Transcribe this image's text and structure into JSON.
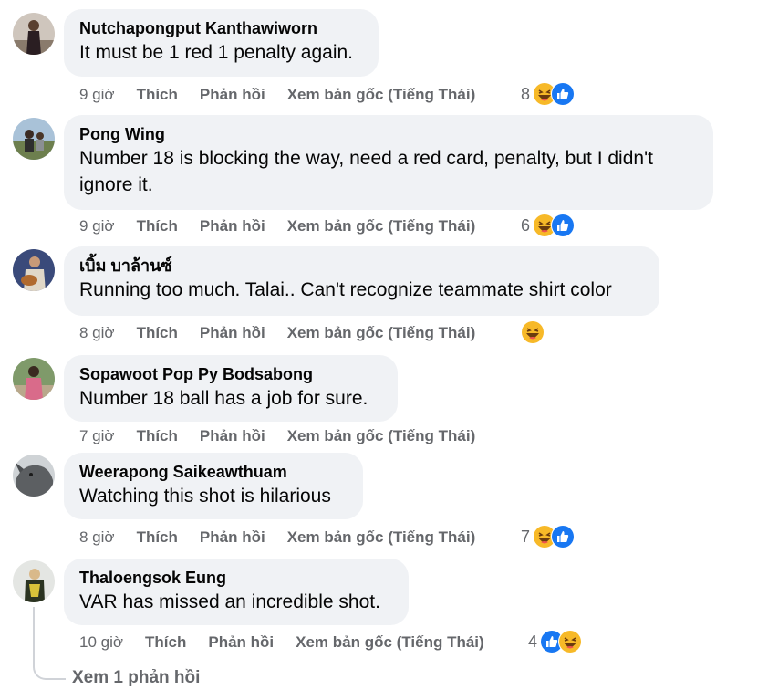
{
  "comments": [
    {
      "author": "Nutchapongput Kanthawiworn",
      "text": "It must be 1 red 1 penalty again.",
      "time": "9 giờ",
      "like": "Thích",
      "reply": "Phản hồi",
      "translate": "Xem bản gốc (Tiếng Thái)",
      "reaction_count": "8",
      "reactions": [
        "haha-icon",
        "like-icon"
      ]
    },
    {
      "author": "Pong Wing",
      "text": "Number 18 is blocking the way, need a red card, penalty, but I didn't ignore it.",
      "time": "9 giờ",
      "like": "Thích",
      "reply": "Phản hồi",
      "translate": "Xem bản gốc (Tiếng Thái)",
      "reaction_count": "6",
      "reactions": [
        "haha-icon",
        "like-icon"
      ]
    },
    {
      "author": "เบิ้ม บาล้านซ์",
      "text": "Running too much. Talai.. Can't recognize teammate shirt color",
      "time": "8 giờ",
      "like": "Thích",
      "reply": "Phản hồi",
      "translate": "Xem bản gốc (Tiếng Thái)",
      "reaction_count": "",
      "reactions": [
        "haha-icon"
      ]
    },
    {
      "author": "Sopawoot Pop Py Bodsabong",
      "text": "Number 18 ball has a job for sure.",
      "time": "7 giờ",
      "like": "Thích",
      "reply": "Phản hồi",
      "translate": "Xem bản gốc (Tiếng Thái)",
      "reaction_count": "",
      "reactions": []
    },
    {
      "author": "Weerapong Saikeawthuam",
      "text": "Watching this shot is hilarious",
      "time": "8 giờ",
      "like": "Thích",
      "reply": "Phản hồi",
      "translate": "Xem bản gốc (Tiếng Thái)",
      "reaction_count": "7",
      "reactions": [
        "haha-icon",
        "like-icon"
      ]
    },
    {
      "author": "Thaloengsok Eung",
      "text": "VAR has missed an incredible shot.",
      "time": "10 giờ",
      "like": "Thích",
      "reply": "Phản hồi",
      "translate": "Xem bản gốc (Tiếng Thái)",
      "reaction_count": "4",
      "reactions": [
        "like-icon",
        "haha-icon"
      ]
    }
  ],
  "view_replies": "Xem 1 phản hồi",
  "colors": {
    "bubble": "#f0f2f5",
    "meta_text": "#65676b",
    "like_blue": "#1877f2",
    "haha_yellow": "#f7b928"
  }
}
